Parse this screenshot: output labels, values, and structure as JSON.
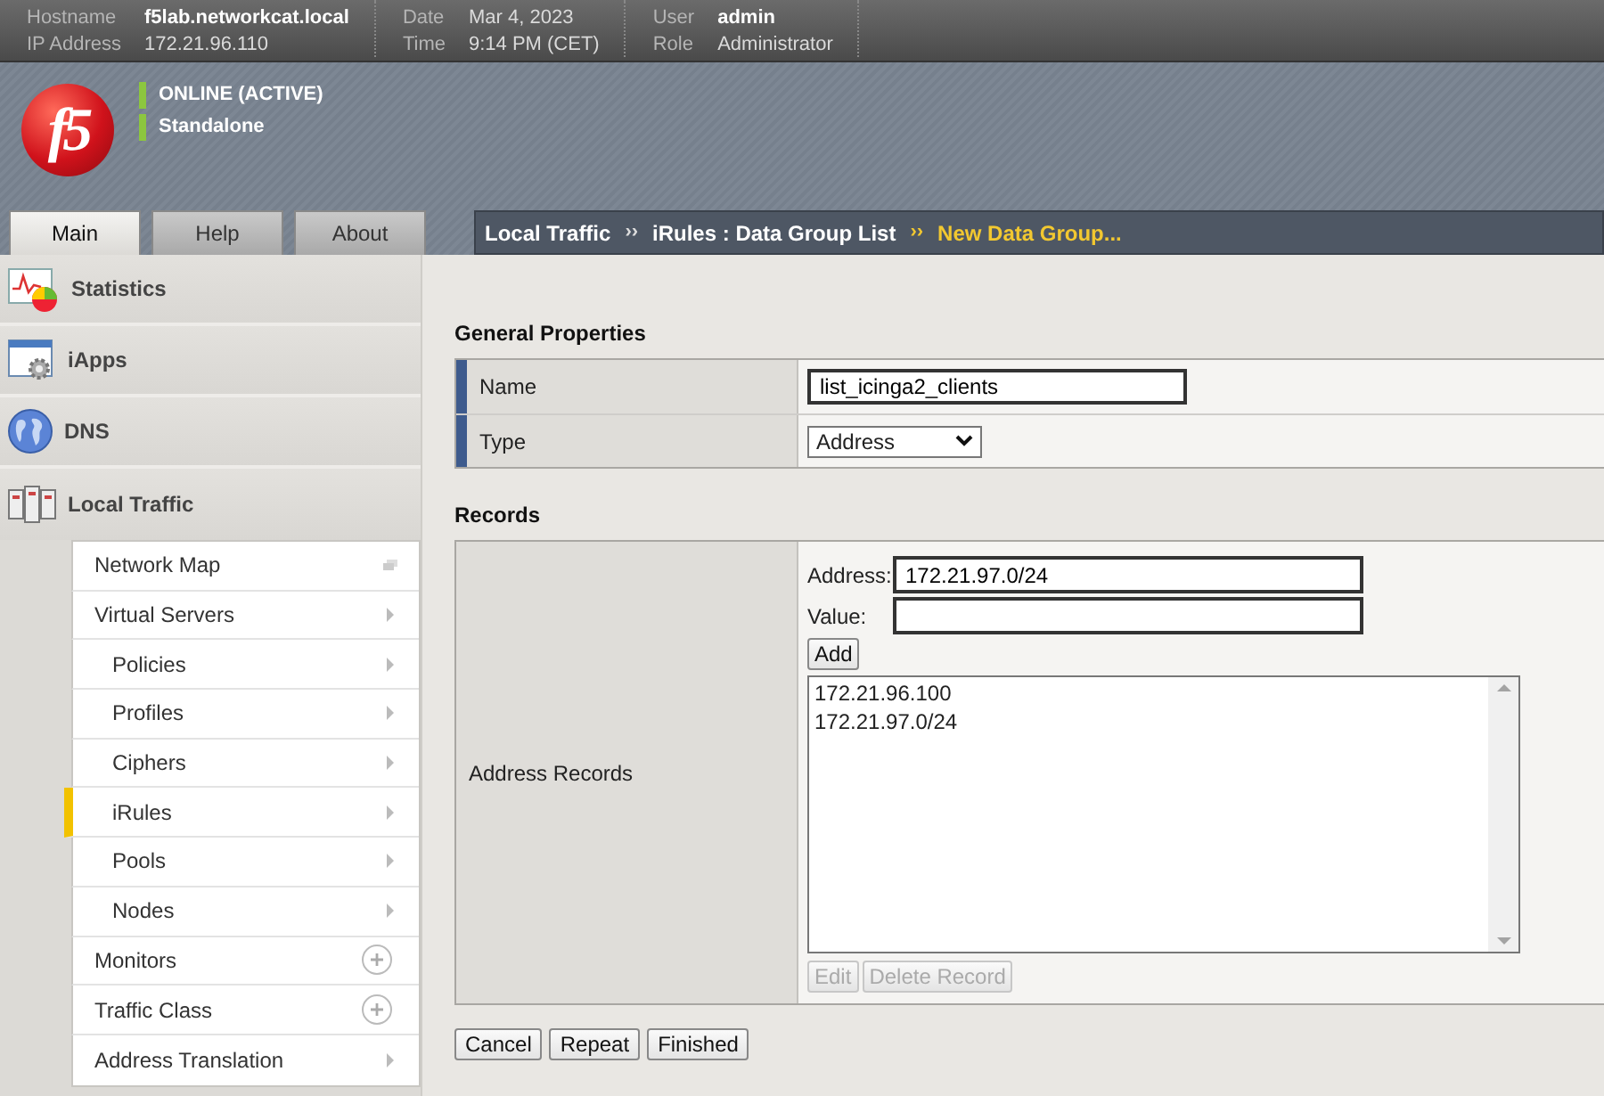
{
  "top_bar": {
    "groups": [
      {
        "fields": [
          {
            "label": "Hostname",
            "value": "f5lab.networkcat.local",
            "emphasis": true
          },
          {
            "label": "IP Address",
            "value": "172.21.96.110",
            "emphasis": false
          }
        ]
      },
      {
        "fields": [
          {
            "label": "Date",
            "value": "Mar 4, 2023",
            "emphasis": false
          },
          {
            "label": "Time",
            "value": "9:14 PM (CET)",
            "emphasis": false
          }
        ]
      },
      {
        "fields": [
          {
            "label": "User",
            "value": "admin",
            "emphasis": true
          },
          {
            "label": "Role",
            "value": "Administrator",
            "emphasis": false
          }
        ]
      }
    ]
  },
  "logo": {
    "text": "f5"
  },
  "status": [
    "ONLINE (ACTIVE)",
    "Standalone"
  ],
  "tabs": [
    {
      "label": "Main",
      "selected": true
    },
    {
      "label": "Help",
      "selected": false
    },
    {
      "label": "About",
      "selected": false
    }
  ],
  "breadcrumb": [
    {
      "text": "Local Traffic",
      "current": false
    },
    {
      "separator": "››",
      "text": "iRules : Data Group List",
      "current": false
    },
    {
      "separator": "››",
      "text": "New Data Group...",
      "current": true
    }
  ],
  "sidebar": {
    "sections": [
      {
        "label": "Statistics",
        "kind": "statistics"
      },
      {
        "label": "iApps",
        "kind": "iapps"
      },
      {
        "label": "DNS",
        "kind": "dns"
      },
      {
        "label": "Local Traffic",
        "kind": "traffic"
      }
    ],
    "items": [
      {
        "label": "Network Map",
        "kind": "popout",
        "selected": false
      },
      {
        "label": "Virtual Servers",
        "kind": "arrow",
        "selected": false,
        "children": [
          {
            "label": "Policies",
            "kind": "arrow",
            "selected": false
          },
          {
            "label": "Profiles",
            "kind": "arrow",
            "selected": false
          },
          {
            "label": "Ciphers",
            "kind": "arrow",
            "selected": false
          },
          {
            "label": "iRules",
            "kind": "arrow",
            "selected": true
          },
          {
            "label": "Pools",
            "kind": "arrow",
            "selected": false
          },
          {
            "label": "Nodes",
            "kind": "arrow",
            "selected": false
          }
        ]
      },
      {
        "label": "Monitors",
        "kind": "plus",
        "selected": false
      },
      {
        "label": "Traffic Class",
        "kind": "plus",
        "selected": false
      },
      {
        "label": "Address Translation",
        "kind": "arrow",
        "selected": false
      }
    ]
  },
  "general_properties": {
    "title": "General Properties",
    "rows": [
      {
        "label": "Name",
        "kind": "text",
        "value": "list_icinga2_clients"
      },
      {
        "label": "Type",
        "kind": "select",
        "value": "Address"
      }
    ]
  },
  "records": {
    "title": "Records",
    "label": "Address Records",
    "address_label": "Address:",
    "address_value": "172.21.97.0/24",
    "value_label": "Value:",
    "add_button": "Add",
    "list": [
      "172.21.96.100",
      "172.21.97.0/24"
    ],
    "list_buttons": [
      {
        "label": "Edit",
        "disabled": true
      },
      {
        "label": "Delete Record",
        "disabled": true
      }
    ]
  },
  "buttons": [
    "Cancel",
    "Repeat",
    "Finished"
  ]
}
